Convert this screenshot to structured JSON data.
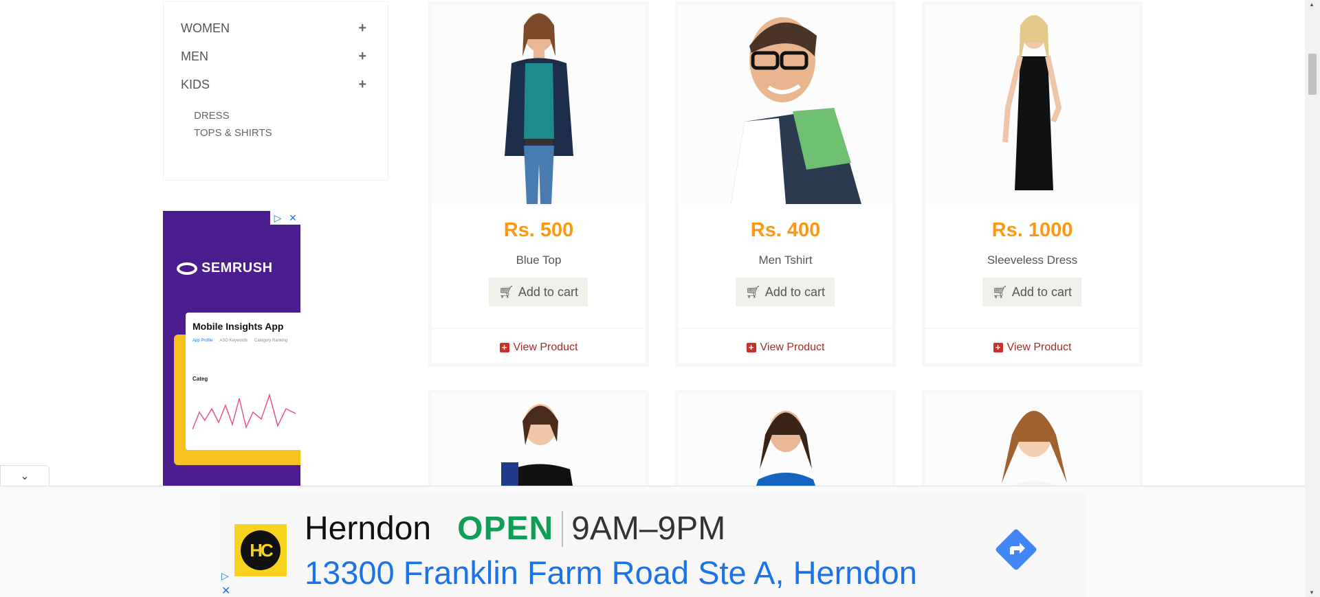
{
  "sidebar": {
    "categories": [
      {
        "label": "WOMEN",
        "toggle": "+"
      },
      {
        "label": "MEN",
        "toggle": "+"
      },
      {
        "label": "KIDS",
        "toggle": "+"
      }
    ],
    "kids_subcategories": [
      "DRESS",
      "TOPS & SHIRTS"
    ]
  },
  "side_ad": {
    "brand": "SEMRUSH",
    "card_title": "Mobile Insights App",
    "tabs": [
      "App Profile",
      "ASO Keywords",
      "Category Ranking"
    ],
    "chart_label": "Categ",
    "choices_icon": "adchoices-icon",
    "close_icon": "close-icon"
  },
  "products": [
    {
      "price": "Rs. 500",
      "name": "Blue Top",
      "add_label": "Add to cart",
      "view_label": "View Product",
      "shirt_color": "#1f8a8c",
      "jacket_color": "#1c2e4a"
    },
    {
      "price": "Rs. 400",
      "name": "Men Tshirt",
      "add_label": "Add to cart",
      "view_label": "View Product",
      "shirt_color": "#2b3a4f",
      "jacket_color": "#6fbf73"
    },
    {
      "price": "Rs. 1000",
      "name": "Sleeveless Dress",
      "add_label": "Add to cart",
      "view_label": "View Product",
      "shirt_color": "#111111",
      "jacket_color": "#111111"
    }
  ],
  "products_row2": [
    {
      "top_color": "#111111"
    },
    {
      "top_color": "#1565c0"
    },
    {
      "top_color": "#ffffff"
    }
  ],
  "bottom_ad": {
    "logo_text": "HC",
    "store": "Herndon",
    "status": "OPEN",
    "hours": "9AM–9PM",
    "address": "13300 Franklin Farm Road Ste A, Herndon",
    "direction_icon": "directions-icon"
  },
  "colors": {
    "price": "#fe980f",
    "view_product": "#a52a2a",
    "open": "#0f9d58",
    "address": "#1a73e8"
  }
}
